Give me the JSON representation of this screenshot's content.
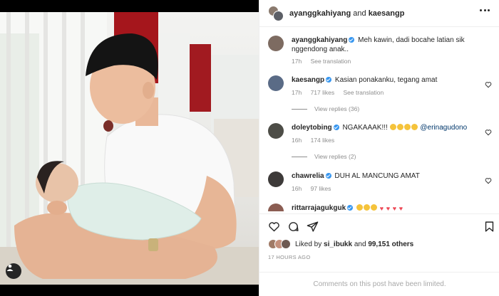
{
  "header": {
    "user1": "ayanggkahiyang",
    "joiner": "and",
    "user2": "kaesangp"
  },
  "caption": {
    "username": "ayanggkahiyang",
    "text": "Meh kawin, dadi bocahe latian sik nggendong anak..",
    "time": "17h",
    "translation": "See translation"
  },
  "comments": [
    {
      "username": "kaesangp",
      "text": "Kasian ponakanku, tegang amat",
      "time": "17h",
      "likes": "717 likes",
      "translation": "See translation",
      "replies": "View replies (36)"
    },
    {
      "username": "doleytobing",
      "text": "NGAKAAAK!!!",
      "mention": "@erinagudono",
      "time": "16h",
      "likes": "174 likes",
      "replies": "View replies (2)"
    },
    {
      "username": "chawrelia",
      "text": "DUH AL MANCUNG AMAT",
      "time": "16h",
      "likes": "97 likes"
    },
    {
      "username": "rittarrajagukguk",
      "text": ""
    }
  ],
  "likes": {
    "prefix": "Liked by",
    "user": "si_ibukk",
    "joiner": "and",
    "others": "99,151 others"
  },
  "timestamp": "17 HOURS AGO",
  "comments_limited": "Comments on this post have been limited.",
  "colors": {
    "verified": "#3897f0",
    "secondary_text": "#8e8e8e",
    "heart": "#ed4956"
  },
  "icons": [
    "heart-icon",
    "comment-icon",
    "share-icon",
    "bookmark-icon",
    "more-icon",
    "user-tag-icon",
    "verified-icon"
  ]
}
